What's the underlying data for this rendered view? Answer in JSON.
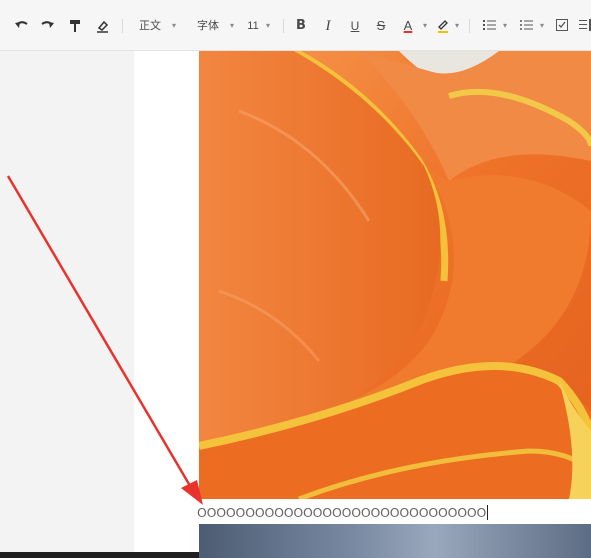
{
  "toolbar": {
    "style_label": "正文",
    "font_label": "字体",
    "size_label": "11",
    "bold_label": "B",
    "italic_label": "I",
    "underline_label": "U",
    "strike_label": "S",
    "color_label": "A",
    "icons": [
      "undo-icon",
      "redo-icon",
      "paint-format-icon",
      "clear-format-icon",
      "highlight-icon",
      "ordered-list-icon",
      "bullet-list-icon",
      "checklist-icon"
    ]
  },
  "document": {
    "typed_text": "OOOOOOOOOOOOOOOOOOOOOOOOOOOOOO"
  },
  "colors": {
    "accent_arrow": "#e8332d",
    "petal": "#f07a2e",
    "petal_edge": "#f3c13a"
  }
}
